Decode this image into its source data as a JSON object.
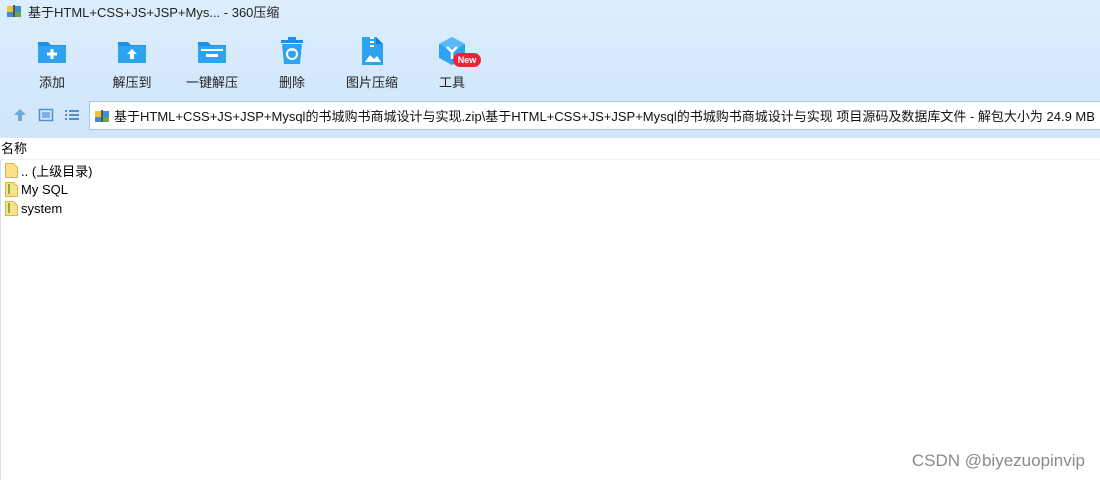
{
  "window": {
    "title": "基于HTML+CSS+JS+JSP+Mys... - 360压缩",
    "app_icon": "360zip-archive-icon"
  },
  "toolbar": {
    "items": [
      {
        "label": "添加",
        "icon": "add-folder-icon"
      },
      {
        "label": "解压到",
        "icon": "extract-to-folder-icon"
      },
      {
        "label": "一键解压",
        "icon": "one-click-extract-icon"
      },
      {
        "label": "删除",
        "icon": "delete-trash-icon"
      },
      {
        "label": "图片压缩",
        "icon": "image-compress-icon"
      },
      {
        "label": "工具",
        "icon": "tools-icon"
      }
    ],
    "badge": "New"
  },
  "nav": {
    "path": "基于HTML+CSS+JS+JSP+Mysql的书城购书商城设计与实现.zip\\基于HTML+CSS+JS+JSP+Mysql的书城购书商城设计与实现 项目源码及数据库文件 - 解包大小为 24.9 MB"
  },
  "list": {
    "column_name": "名称",
    "rows": [
      {
        "name": ".. (上级目录)",
        "icon": "folder-icon"
      },
      {
        "name": "My SQL",
        "icon": "folder-icon"
      },
      {
        "name": "system",
        "icon": "folder-icon"
      }
    ]
  },
  "watermark": "CSDN @biyezuopinvip",
  "colors": {
    "accent": "#1e90e6",
    "toolbar_bg": "#d4e8fb",
    "badge": "#e8263b",
    "folder": "#f6d571"
  }
}
